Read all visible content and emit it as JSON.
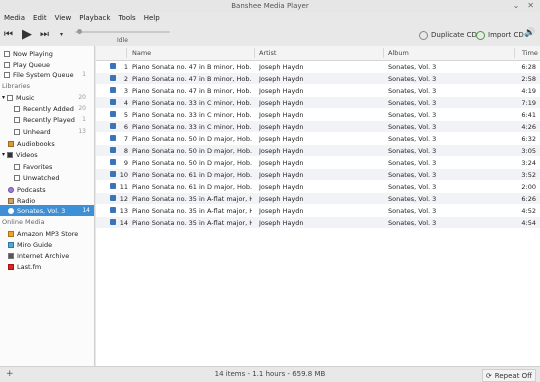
{
  "window": {
    "title": "Banshee Media Player"
  },
  "menu": [
    "Media",
    "Edit",
    "View",
    "Playback",
    "Tools",
    "Help"
  ],
  "playback": {
    "state": "Idle"
  },
  "actions": {
    "duplicate_cd": "Duplicate CD",
    "import_cd": "Import CD"
  },
  "sidebar": {
    "top": [
      {
        "label": "Now Playing"
      },
      {
        "label": "Play Queue"
      },
      {
        "label": "File System Queue",
        "count": "1"
      }
    ],
    "libraries_header": "Libraries",
    "libraries": [
      {
        "label": "Music",
        "count": "20"
      },
      {
        "label": "Recently Added",
        "count": "20"
      },
      {
        "label": "Recently Played",
        "count": "1"
      },
      {
        "label": "Unheard",
        "count": "13"
      },
      {
        "label": "Audiobooks"
      },
      {
        "label": "Videos"
      },
      {
        "label": "Favorites"
      },
      {
        "label": "Unwatched"
      },
      {
        "label": "Podcasts"
      },
      {
        "label": "Radio"
      },
      {
        "label": "Sonates, Vol. 3",
        "count": "14"
      }
    ],
    "online_header": "Online Media",
    "online": [
      {
        "label": "Amazon MP3 Store"
      },
      {
        "label": "Miro Guide"
      },
      {
        "label": "Internet Archive"
      },
      {
        "label": "Last.fm"
      }
    ]
  },
  "columns": {
    "name": "Name",
    "artist": "Artist",
    "album": "Album",
    "time": "Time"
  },
  "tracks": [
    {
      "n": "1",
      "name": "Piano Sonata no. 47 in B minor, Hob. XVI:...",
      "artist": "Joseph Haydn",
      "album": "Sonates, Vol. 3",
      "time": "6:28"
    },
    {
      "n": "2",
      "name": "Piano Sonata no. 47 in B minor, Hob. XVI:...",
      "artist": "Joseph Haydn",
      "album": "Sonates, Vol. 3",
      "time": "2:58"
    },
    {
      "n": "3",
      "name": "Piano Sonata no. 47 in B minor, Hob. XVI:...",
      "artist": "Joseph Haydn",
      "album": "Sonates, Vol. 3",
      "time": "4:19"
    },
    {
      "n": "4",
      "name": "Piano Sonata no. 33 in C minor, Hob. XVI:...",
      "artist": "Joseph Haydn",
      "album": "Sonates, Vol. 3",
      "time": "7:19"
    },
    {
      "n": "5",
      "name": "Piano Sonata no. 33 in C minor, Hob. XVI:...",
      "artist": "Joseph Haydn",
      "album": "Sonates, Vol. 3",
      "time": "6:41"
    },
    {
      "n": "6",
      "name": "Piano Sonata no. 33 in C minor, Hob. XVI:...",
      "artist": "Joseph Haydn",
      "album": "Sonates, Vol. 3",
      "time": "4:26"
    },
    {
      "n": "7",
      "name": "Piano Sonata no. 50 in D major, Hob. XVI:...",
      "artist": "Joseph Haydn",
      "album": "Sonates, Vol. 3",
      "time": "6:32"
    },
    {
      "n": "8",
      "name": "Piano Sonata no. 50 in D major, Hob. XVI:...",
      "artist": "Joseph Haydn",
      "album": "Sonates, Vol. 3",
      "time": "3:05"
    },
    {
      "n": "9",
      "name": "Piano Sonata no. 50 in D major, Hob. XVI:...",
      "artist": "Joseph Haydn",
      "album": "Sonates, Vol. 3",
      "time": "3:24"
    },
    {
      "n": "10",
      "name": "Piano Sonata no. 61 in D major, Hob. XVI:...",
      "artist": "Joseph Haydn",
      "album": "Sonates, Vol. 3",
      "time": "3:52"
    },
    {
      "n": "11",
      "name": "Piano Sonata no. 61 in D major, Hob. XVI:...",
      "artist": "Joseph Haydn",
      "album": "Sonates, Vol. 3",
      "time": "2:00"
    },
    {
      "n": "12",
      "name": "Piano Sonata no. 35 in A-flat major, Hob. ...",
      "artist": "Joseph Haydn",
      "album": "Sonates, Vol. 3",
      "time": "6:26"
    },
    {
      "n": "13",
      "name": "Piano Sonata no. 35 in A-flat major, Hob. ...",
      "artist": "Joseph Haydn",
      "album": "Sonates, Vol. 3",
      "time": "4:52"
    },
    {
      "n": "14",
      "name": "Piano Sonata no. 35 in A-flat major, Hob. ...",
      "artist": "Joseph Haydn",
      "album": "Sonates, Vol. 3",
      "time": "4:54"
    }
  ],
  "status": {
    "summary": "14 items - 1.1 hours - 659.8 MB",
    "repeat": "Repeat Off"
  }
}
